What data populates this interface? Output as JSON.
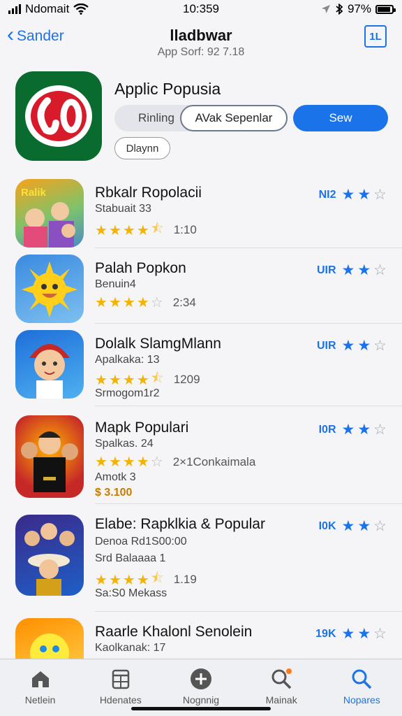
{
  "status_bar": {
    "carrier": "Ndomait",
    "time": "10:359",
    "battery": "97%"
  },
  "nav": {
    "back_label": "Sander",
    "title": "lladbwar",
    "subtitle": "App Sorf: 92 7.18",
    "share_label": "1L"
  },
  "hero": {
    "title": "Applic Popusia",
    "segments": [
      "Rinling",
      "AVak Sepenlar",
      "Sew"
    ],
    "small_pill": "Dlaynn",
    "icon_text": "϶0"
  },
  "apps": [
    {
      "title": "Rbkalr Ropolacii",
      "sub": "Stabuait 33",
      "rating": 4.5,
      "count": "1:10",
      "label": "NI2",
      "blue_stars": 2,
      "extra": ""
    },
    {
      "title": "Palah Popkon",
      "sub": "Benuin4",
      "rating": 4.0,
      "count": "2:34",
      "label": "UIR",
      "blue_stars": 2,
      "extra": ""
    },
    {
      "title": "Dolalk SlamgMlann",
      "sub": "Apalkaka: 13",
      "rating": 4.5,
      "count": "1209",
      "label": "UIR",
      "blue_stars": 2,
      "extra": "Srmogom1r2"
    },
    {
      "title": "Mapk Populari",
      "sub": "Spalkas. 24",
      "rating": 4.0,
      "count": "2×1Conkaimala",
      "label": "I0R",
      "blue_stars": 2,
      "extra": "Amotk 3",
      "extra2": "$ 3.100"
    },
    {
      "title": "Elabe: Rapklkia & Popular",
      "sub": "Denoa Rd1S00:00",
      "sub2": "Srd Balaaaa 1",
      "rating": 4.5,
      "count": "1.19",
      "label": "I0K",
      "blue_stars": 2,
      "extra": "Sa:S0 Mekass"
    },
    {
      "title": "Raarle Khalonl Senolein",
      "sub": "Kaolkanak: 17",
      "rating": 0,
      "count": "",
      "label": "19K",
      "blue_stars": 2,
      "extra": ""
    }
  ],
  "tabs": [
    {
      "label": "Netlein",
      "icon": "home-icon"
    },
    {
      "label": "Hdenates",
      "icon": "calendar-icon"
    },
    {
      "label": "Nognnig",
      "icon": "add-circle-icon"
    },
    {
      "label": "Mainak",
      "icon": "search-icon"
    },
    {
      "label": "Nopares",
      "icon": "search-icon",
      "active": true
    }
  ],
  "colors": {
    "accent": "#1a73e8",
    "star": "#f5b301",
    "hero_icon_bg": "#0a6b2e",
    "hero_icon_red": "#d81b2b"
  }
}
